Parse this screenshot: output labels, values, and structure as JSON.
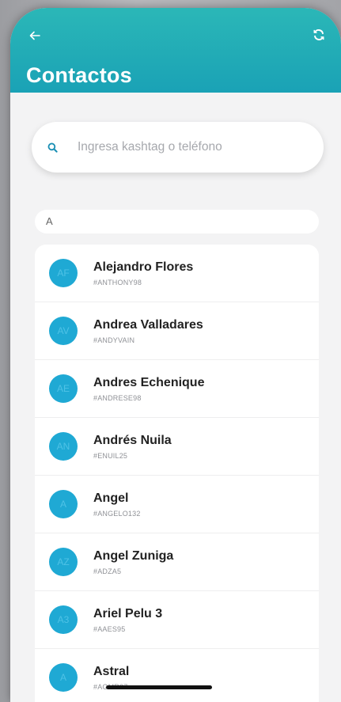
{
  "header": {
    "title": "Contactos",
    "back_icon": "arrow-left-icon",
    "sync_icon": "sync-icon",
    "color_top": "#2bb7b7",
    "color_bottom": "#1aa2b6"
  },
  "search": {
    "placeholder": "Ingresa kashtag o teléfono",
    "value": "",
    "icon": "search-icon",
    "icon_color": "#1a8fb4"
  },
  "section": {
    "letter": "A"
  },
  "contacts": [
    {
      "initials": "AF",
      "name": "Alejandro Flores",
      "tag": "#ANTHONY98"
    },
    {
      "initials": "AV",
      "name": "Andrea Valladares",
      "tag": "#ANDYVAIN"
    },
    {
      "initials": "AE",
      "name": "Andres Echenique",
      "tag": "#ANDRESE98"
    },
    {
      "initials": "AN",
      "name": "Andrés Nuila",
      "tag": "#ENUIL25"
    },
    {
      "initials": "A",
      "name": "Angel",
      "tag": "#ANGELO132"
    },
    {
      "initials": "AZ",
      "name": "Angel Zuniga",
      "tag": "#ADZA5"
    },
    {
      "initials": "A3",
      "name": "Ariel Pelu 3",
      "tag": "#AAES95"
    },
    {
      "initials": "A",
      "name": "Astral",
      "tag": "#AGMR27"
    }
  ],
  "colors": {
    "avatar_bg": "#1fa9d4",
    "accent": "#1aa2b6"
  }
}
